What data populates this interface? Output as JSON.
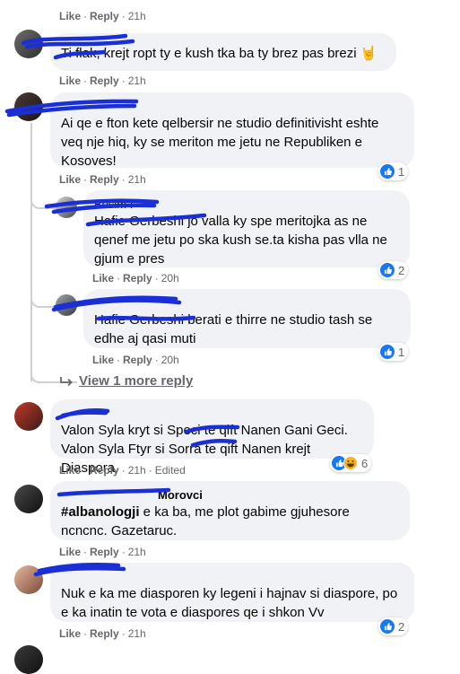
{
  "top_meta": {
    "like": "Like",
    "reply": "Reply",
    "time": "21h"
  },
  "comments": [
    {
      "text": "Ti flak, krejt ropt ty e kush tka ba ty brez pas brezi 🤘",
      "like": "Like",
      "reply": "Reply",
      "time": "21h"
    },
    {
      "text": "Ai qe e fton kete qelbersir ne studio definitivisht eshte veq nje hiq, ky se meriton me jetu ne Republiken e Kosoves!",
      "like": "Like",
      "reply": "Reply",
      "time": "21h",
      "reactions": "1"
    },
    {
      "name": "Besim I",
      "text": "Hafie Gerbeshi jo valla ky spe meritojka as ne qenef me jetu po ska kush se.ta kisha pas vlla ne gjum e pres",
      "like": "Like",
      "reply": "Reply",
      "time": "20h",
      "reactions": "2"
    },
    {
      "text": "Hafie Gerbeshi berati e thirre ne studio tash se edhe aj qasi muti",
      "like": "Like",
      "reply": "Reply",
      "time": "20h",
      "reactions": "1"
    },
    {
      "line1": "Valon Syla kryt si Speci te qift Nanen Gani Geci.",
      "line2": "Valon Syla Ftyr si Sorra te qift Nanen krejt Diaspora.",
      "like": "Like",
      "reply": "Reply",
      "time": "21h",
      "edited": "Edited",
      "reactions": "6"
    },
    {
      "name": "Morovci",
      "hashtag": "#albanologji",
      "text": " e ka ba, me plot gabime gjuhesore ncncnc. Gazetaruc.",
      "like": "Like",
      "reply": "Reply",
      "time": "21h"
    },
    {
      "text": "Nuk e ka me diasporen ky legeni i hajnav si diaspore, po e ka inatin te vota e diaspores qe i shkon Vv",
      "like": "Like",
      "reply": "Reply",
      "time": "21h",
      "reactions": "2"
    }
  ],
  "view_more": "View 1 more reply",
  "colors": {
    "accent": "#1877f2",
    "bubble": "#f0f2f5",
    "meta": "#65676b",
    "scribble": "#1a2fd6"
  }
}
